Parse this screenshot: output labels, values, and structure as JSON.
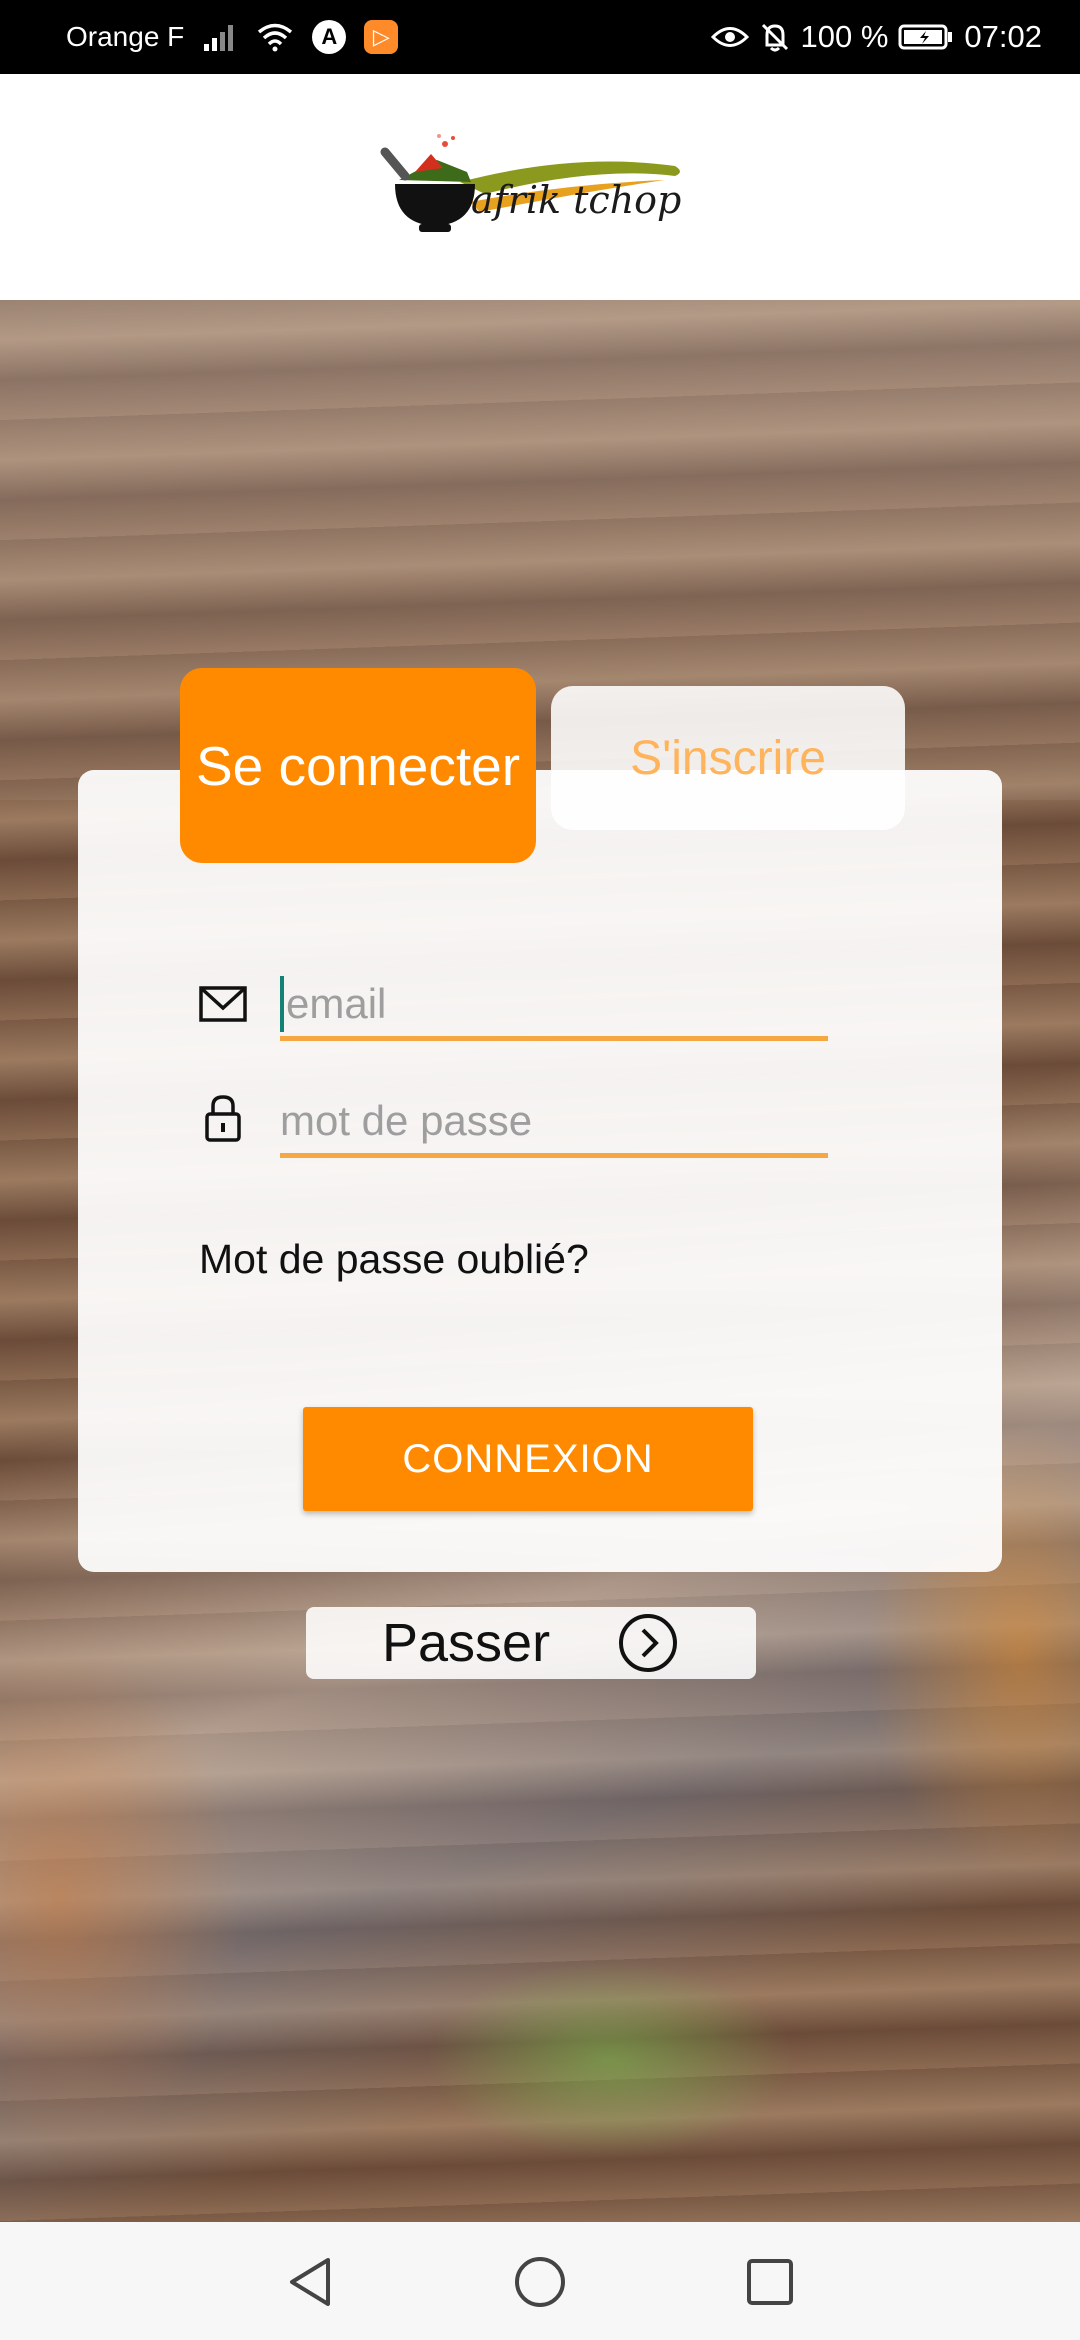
{
  "status_bar": {
    "carrier": "Orange F",
    "battery_percent": "100 %",
    "time": "07:02",
    "icons": [
      "signal-icon",
      "wifi-icon",
      "app-a-icon",
      "app-play-icon",
      "eye-icon",
      "bell-off-icon",
      "battery-icon"
    ]
  },
  "header": {
    "logo_text": "afrik tchop",
    "logo_icon": "mortar-bowl-icon"
  },
  "auth_tabs": {
    "login_label": "Se connecter",
    "signup_label": "S'inscrire",
    "active": "login"
  },
  "form": {
    "email_placeholder": "email",
    "email_value": "",
    "password_placeholder": "mot de passe",
    "password_value": "",
    "email_icon": "envelope-icon",
    "password_icon": "lock-icon"
  },
  "forgot_password": "Mot de passe oublié?",
  "connexion_button": "CONNEXION",
  "skip_button": {
    "label": "Passer",
    "icon": "chevron-right-circle-icon"
  },
  "colors": {
    "accent": "#ff8a00",
    "underline": "#f5a742",
    "inactive_tab_text": "#ffb35a",
    "caret": "#128275"
  },
  "navbar": {
    "icons": [
      "back-icon",
      "home-icon",
      "recents-icon"
    ]
  }
}
